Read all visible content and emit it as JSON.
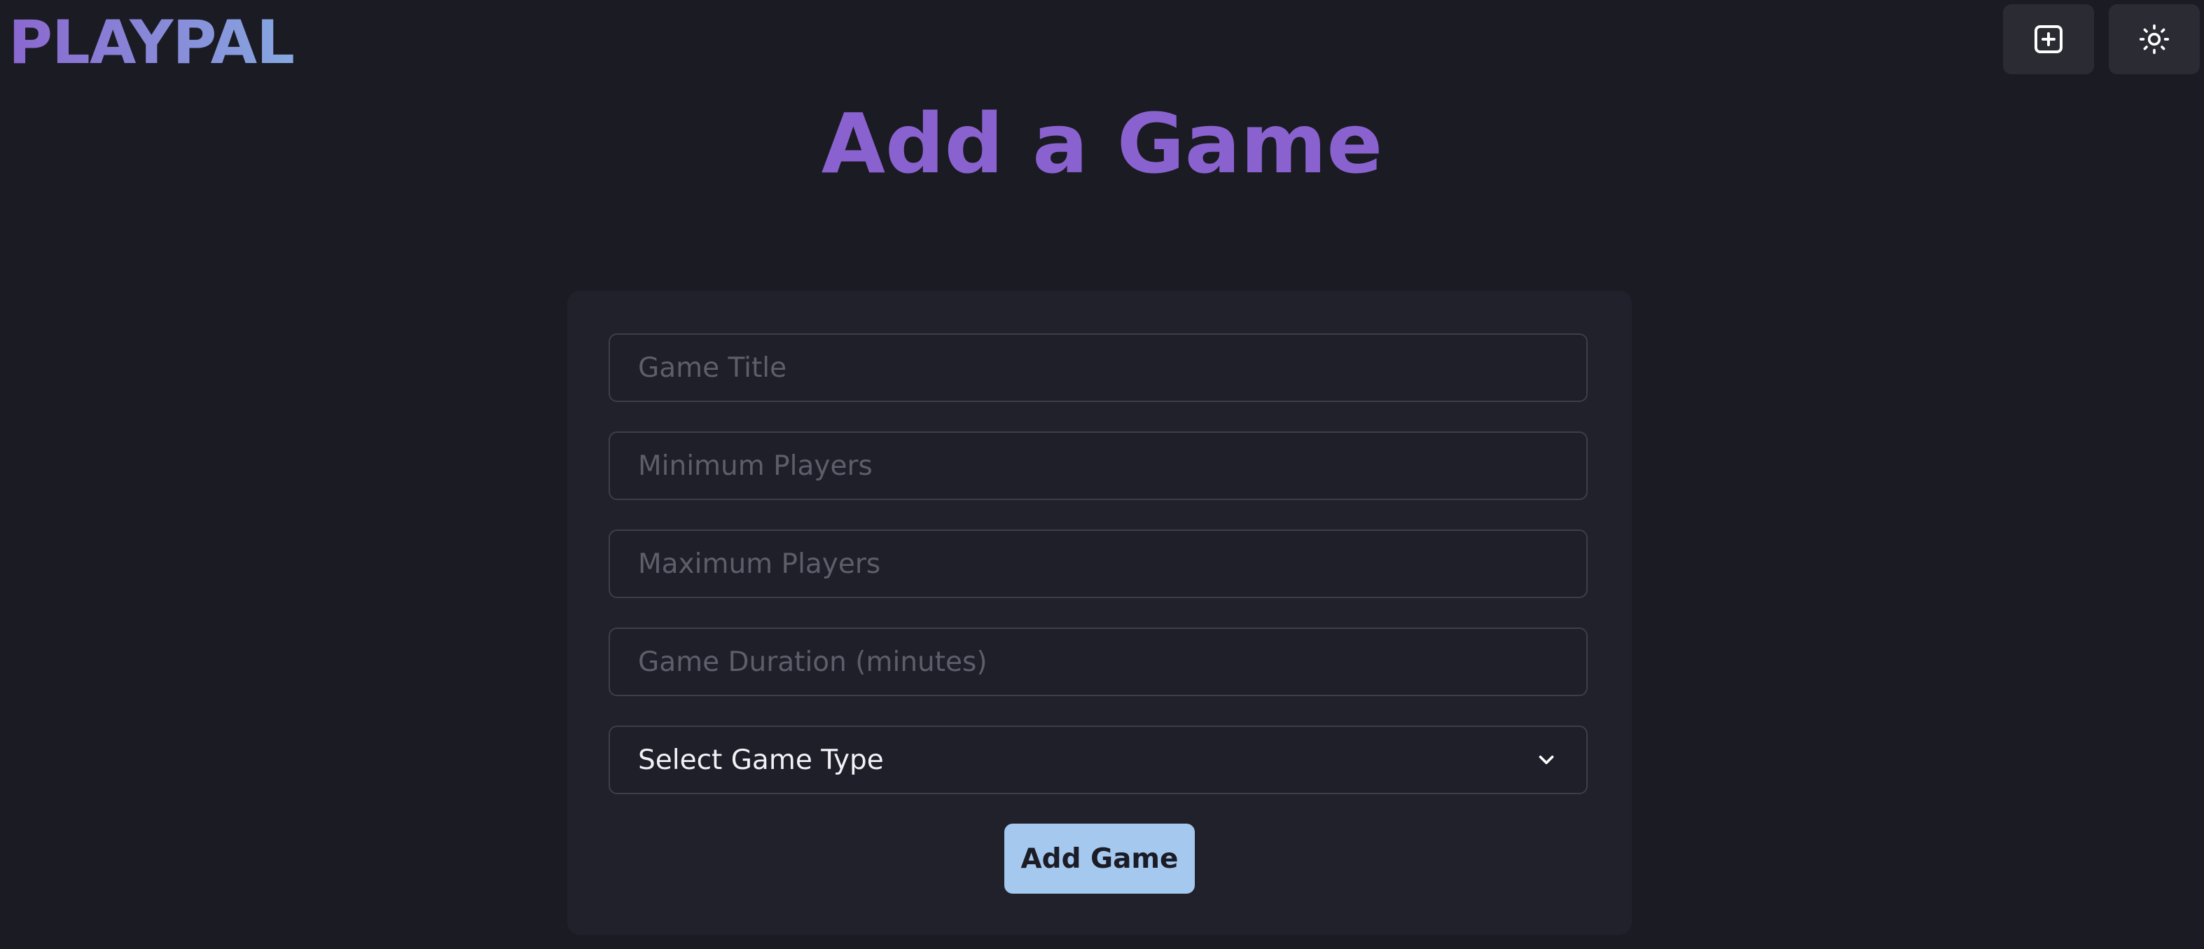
{
  "header": {
    "logo_text": "PLAYPAL",
    "add_icon": "plus-square-icon",
    "theme_icon": "sun-icon"
  },
  "main": {
    "title": "Add a Game"
  },
  "form": {
    "game_title": {
      "value": "",
      "placeholder": "Game Title"
    },
    "min_players": {
      "value": "",
      "placeholder": "Minimum Players"
    },
    "max_players": {
      "value": "",
      "placeholder": "Maximum Players"
    },
    "duration": {
      "value": "",
      "placeholder": "Game Duration (minutes)"
    },
    "game_type": {
      "selected": "Select Game Type",
      "icon": "chevron-down-icon"
    },
    "submit_label": "Add Game"
  },
  "colors": {
    "background": "#1b1b23",
    "card": "#20212b",
    "title_purple": "#8a62cf",
    "logo_gradient_start": "#8a67cf",
    "logo_gradient_end": "#86a8e0",
    "button_blue": "#a5c8ef"
  }
}
